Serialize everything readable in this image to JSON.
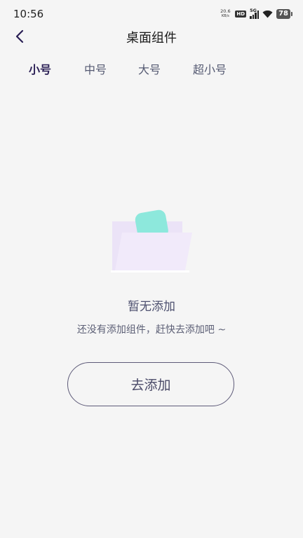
{
  "status_bar": {
    "time": "10:56",
    "net_speed_value": "20.6",
    "net_speed_unit": "KB/s",
    "hd": "HD",
    "network": "5G",
    "battery": "78"
  },
  "header": {
    "title": "桌面组件"
  },
  "tabs": [
    {
      "label": "小号",
      "active": true
    },
    {
      "label": "中号",
      "active": false
    },
    {
      "label": "大号",
      "active": false
    },
    {
      "label": "超小号",
      "active": false
    }
  ],
  "empty_state": {
    "title": "暂无添加",
    "description": "还没有添加组件，赶快去添加吧 ~",
    "button_label": "去添加"
  },
  "colors": {
    "accent": "#2a1f55",
    "background": "#f5f5f5",
    "folder_back": "#ebe3f7",
    "folder_front": "#f1eafa",
    "folder_card": "#8de8dc"
  }
}
